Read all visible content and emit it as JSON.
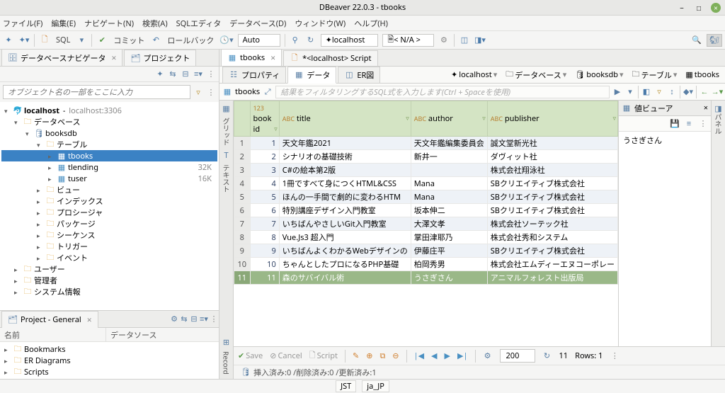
{
  "window": {
    "title": "DBeaver 22.0.3 - tbooks"
  },
  "menubar": [
    "ファイル(F)",
    "編集(E)",
    "ナビゲート(N)",
    "検索(A)",
    "SQLエディタ",
    "データベース(D)",
    "ウィンドウ(W)",
    "ヘルプ(H)"
  ],
  "toolbar": {
    "sql": "SQL",
    "commit": "コミット",
    "rollback": "ロールバック",
    "auto": "Auto",
    "conn": "localhost",
    "schema": "< N/A >"
  },
  "nav": {
    "tab1": "データベースナビゲータ",
    "tab2": "プロジェクト",
    "search_placeholder": "オブジェクト名の一部をここに入力",
    "root": {
      "label": "localhost",
      "suffix": "localhost:3306"
    },
    "db": "データベース",
    "schema": "booksdb",
    "tables_label": "テーブル",
    "tables": [
      {
        "name": "tbooks",
        "selected": true
      },
      {
        "name": "tlending",
        "count": "32K"
      },
      {
        "name": "tuser",
        "count": "16K"
      }
    ],
    "folders": [
      "ビュー",
      "インデックス",
      "プロシージャ",
      "パッケージ",
      "シーケンス",
      "トリガー",
      "イベント"
    ],
    "bottom": [
      "ユーザー",
      "管理者",
      "システム情報"
    ]
  },
  "project": {
    "title": "Project - General",
    "cols": [
      "名前",
      "データソース"
    ],
    "items": [
      "Bookmarks",
      "ER Diagrams",
      "Scripts"
    ]
  },
  "editor": {
    "tabs": [
      {
        "label": "tbooks",
        "active": true
      },
      {
        "label": "*<localhost> Script",
        "active": false
      }
    ],
    "subtabs": [
      "プロパティ",
      "データ",
      "ER図"
    ],
    "active_subtab": 1,
    "crumbs": [
      "localhost",
      "データベース",
      "booksdb",
      "テーブル",
      "tbooks"
    ],
    "filter_label": "tbooks",
    "filter_placeholder": "結果をフィルタリングするSQL式を入力します(Ctrl + Spaceを使用)",
    "side_labels": [
      "グリッド",
      "テキスト",
      "Record"
    ],
    "value_viewer": {
      "title": "値ビューア",
      "value": "うさぎさん"
    },
    "columns": [
      {
        "type": "123",
        "name": "book id"
      },
      {
        "type": "ABC",
        "name": "title"
      },
      {
        "type": "ABC",
        "name": "author"
      },
      {
        "type": "ABC",
        "name": "publisher"
      }
    ],
    "rows": [
      {
        "n": 1,
        "id": 1,
        "title": "天文年鑑2021",
        "author": "天文年鑑編集委員会",
        "publisher": "誠文堂新光社"
      },
      {
        "n": 2,
        "id": 2,
        "title": "シナリオの基礎技術",
        "author": "新井一",
        "publisher": "ダヴィット社"
      },
      {
        "n": 3,
        "id": 3,
        "title": "C#の絵本第2版",
        "author": "",
        "publisher": "株式会社翔泳社"
      },
      {
        "n": 4,
        "id": 4,
        "title": "1冊ですべて身につくHTML&CSS",
        "author": "Mana",
        "publisher": "SBクリエイティブ株式会社"
      },
      {
        "n": 5,
        "id": 5,
        "title": "ほんの一手間で劇的に変わるHTM",
        "author": "Mana",
        "publisher": "SBクリエイティブ株式会社"
      },
      {
        "n": 6,
        "id": 6,
        "title": "特別講座デザイン入門教室",
        "author": "坂本伸二",
        "publisher": "SBクリエイティブ株式会社"
      },
      {
        "n": 7,
        "id": 7,
        "title": "いちばんやさしいGit入門教室",
        "author": "大澤文孝",
        "publisher": "株式会社ソーテック社"
      },
      {
        "n": 8,
        "id": 8,
        "title": "Vue.Js3 超入門",
        "author": "掌田津耶乃",
        "publisher": "株式会社秀和システム"
      },
      {
        "n": 9,
        "id": 9,
        "title": "いちばんよくわかるWebデザインの",
        "author": "伊藤庄平",
        "publisher": "SBクリエイティブ株式会社"
      },
      {
        "n": 10,
        "id": 10,
        "title": "ちゃんとしたプロになるPHP基礎",
        "author": "柏岡秀男",
        "publisher": "株式会社エムディーエヌコーポレー"
      },
      {
        "n": 11,
        "id": 11,
        "title": "森のサバイバル術",
        "author": "うさぎさん",
        "publisher": "アニマルフォレスト出版局",
        "selected": true
      }
    ],
    "footer": {
      "save": "Save",
      "cancel": "Cancel",
      "script": "Script",
      "count": "200",
      "result": "11",
      "rows_label": "Rows: 1"
    },
    "status2": "挿入済み:0 /削除済み:0 /更新済み:1",
    "far_right": "パネル"
  },
  "statusbar": [
    "JST",
    "ja_JP"
  ]
}
